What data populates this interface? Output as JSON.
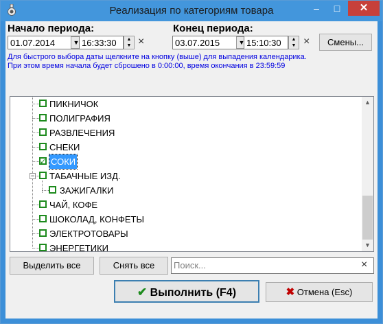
{
  "window": {
    "title": "Реализация по категориям товара",
    "minimize": "–",
    "maximize": "□",
    "close": "✕"
  },
  "period": {
    "start_label": "Начало периода:",
    "start_date": "01.07.2014",
    "start_time": "16:33:30",
    "end_label": "Конец периода:",
    "end_date": "03.07.2015",
    "end_time": "15:10:30",
    "clear_symbol": "×",
    "shifts_button": "Смены..."
  },
  "hint": {
    "line1": "Для быстрого выбора даты щелкните на кнопку (выше) для выпадения календарика.",
    "line2": "При этом время начала будет сброшено в 0:00:00, время окончания в 23:59:59"
  },
  "tree": {
    "items": [
      {
        "label": "ПИКНИЧОК",
        "checked": false,
        "selected": false
      },
      {
        "label": "ПОЛИГРАФИЯ",
        "checked": false,
        "selected": false
      },
      {
        "label": "РАЗВЛЕЧЕНИЯ",
        "checked": false,
        "selected": false
      },
      {
        "label": "СНЕКИ",
        "checked": false,
        "selected": false
      },
      {
        "label": "СОКИ",
        "checked": true,
        "selected": true
      },
      {
        "label": "ТАБАЧНЫЕ ИЗД.",
        "checked": false,
        "selected": false,
        "expander": "−"
      },
      {
        "label": "ЗАЖИГАЛКИ",
        "checked": false,
        "selected": false,
        "child": true
      },
      {
        "label": "ЧАЙ, КОФЕ",
        "checked": false,
        "selected": false
      },
      {
        "label": "ШОКОЛАД, КОНФЕТЫ",
        "checked": false,
        "selected": false
      },
      {
        "label": "ЭЛЕКТРОТОВАРЫ",
        "checked": false,
        "selected": false
      },
      {
        "label": "ЭНЕРГЕТИКИ",
        "checked": false,
        "selected": false
      }
    ]
  },
  "bottom": {
    "select_all": "Выделить все",
    "deselect_all": "Снять все",
    "search_placeholder": "Поиск...",
    "search_clear": "×",
    "execute": "Выполнить (F4)",
    "cancel": "Отмена (Esc)"
  },
  "colors": {
    "titlebar": "#4396dc",
    "close_button": "#c7403a",
    "hint_text": "#0000e0",
    "checkbox": "#1c8a1c",
    "selection": "#3399ff"
  }
}
